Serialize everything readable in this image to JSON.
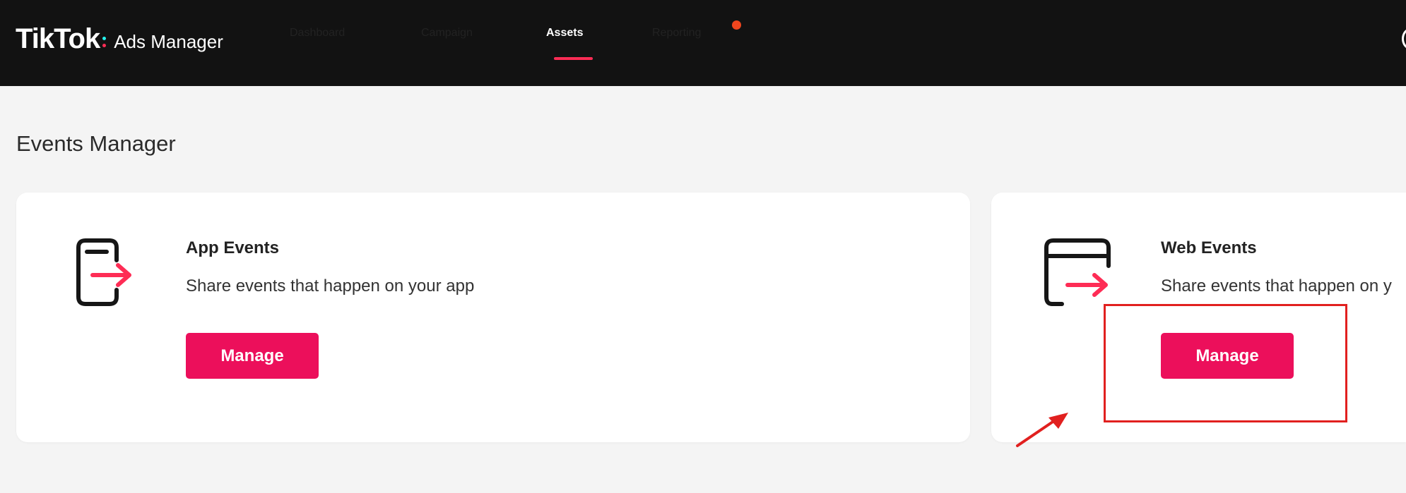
{
  "header": {
    "brand": "TikTok",
    "product": "Ads Manager",
    "nav": [
      {
        "label": "Dashboard",
        "active": false
      },
      {
        "label": "Campaign",
        "active": false
      },
      {
        "label": "Assets",
        "active": true
      },
      {
        "label": "Reporting",
        "active": false,
        "has_notification": true
      }
    ]
  },
  "page": {
    "title": "Events Manager"
  },
  "cards": [
    {
      "title": "App Events",
      "description": "Share events that happen on your app",
      "button_label": "Manage",
      "icon": "app-events-icon"
    },
    {
      "title": "Web Events",
      "description": "Share events that happen on y",
      "button_label": "Manage",
      "icon": "web-events-icon"
    }
  ],
  "colors": {
    "header_bg": "#121212",
    "accent": "#fe2c55",
    "button": "#ec0f5b",
    "notification": "#f0461e",
    "annotation": "#e1201f",
    "page_bg": "#f4f4f4"
  }
}
